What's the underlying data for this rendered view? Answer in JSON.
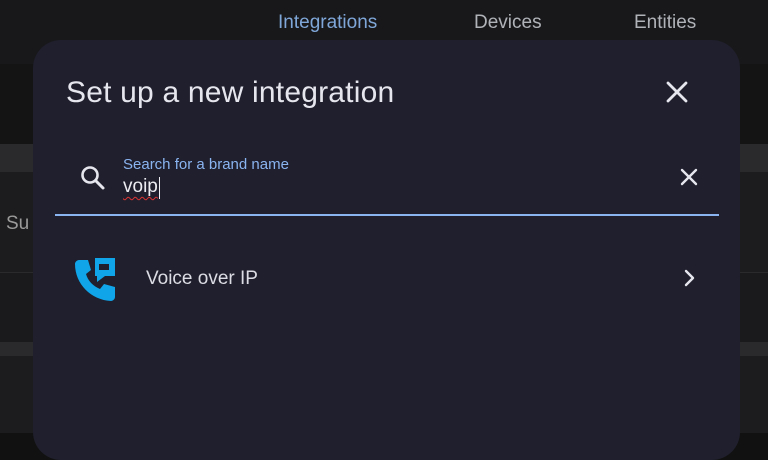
{
  "tabs": [
    {
      "label": "Integrations",
      "active": true
    },
    {
      "label": "Devices",
      "active": false
    },
    {
      "label": "Entities",
      "active": false
    }
  ],
  "background": {
    "partial_text": "Su"
  },
  "dialog": {
    "title": "Set up a new integration",
    "close_icon": "close-icon",
    "search": {
      "label": "Search for a brand name",
      "value": "voip",
      "icon": "search-icon",
      "clear_icon": "clear-icon"
    },
    "results": [
      {
        "label": "Voice over IP",
        "icon": "voip-phone-icon",
        "chevron": "chevron-right-icon"
      }
    ]
  },
  "colors": {
    "accent": "#8ab4f0",
    "dialog_bg": "#1f1f2d",
    "voip_icon": "#10a4e8",
    "spellcheck": "#dd3333"
  }
}
